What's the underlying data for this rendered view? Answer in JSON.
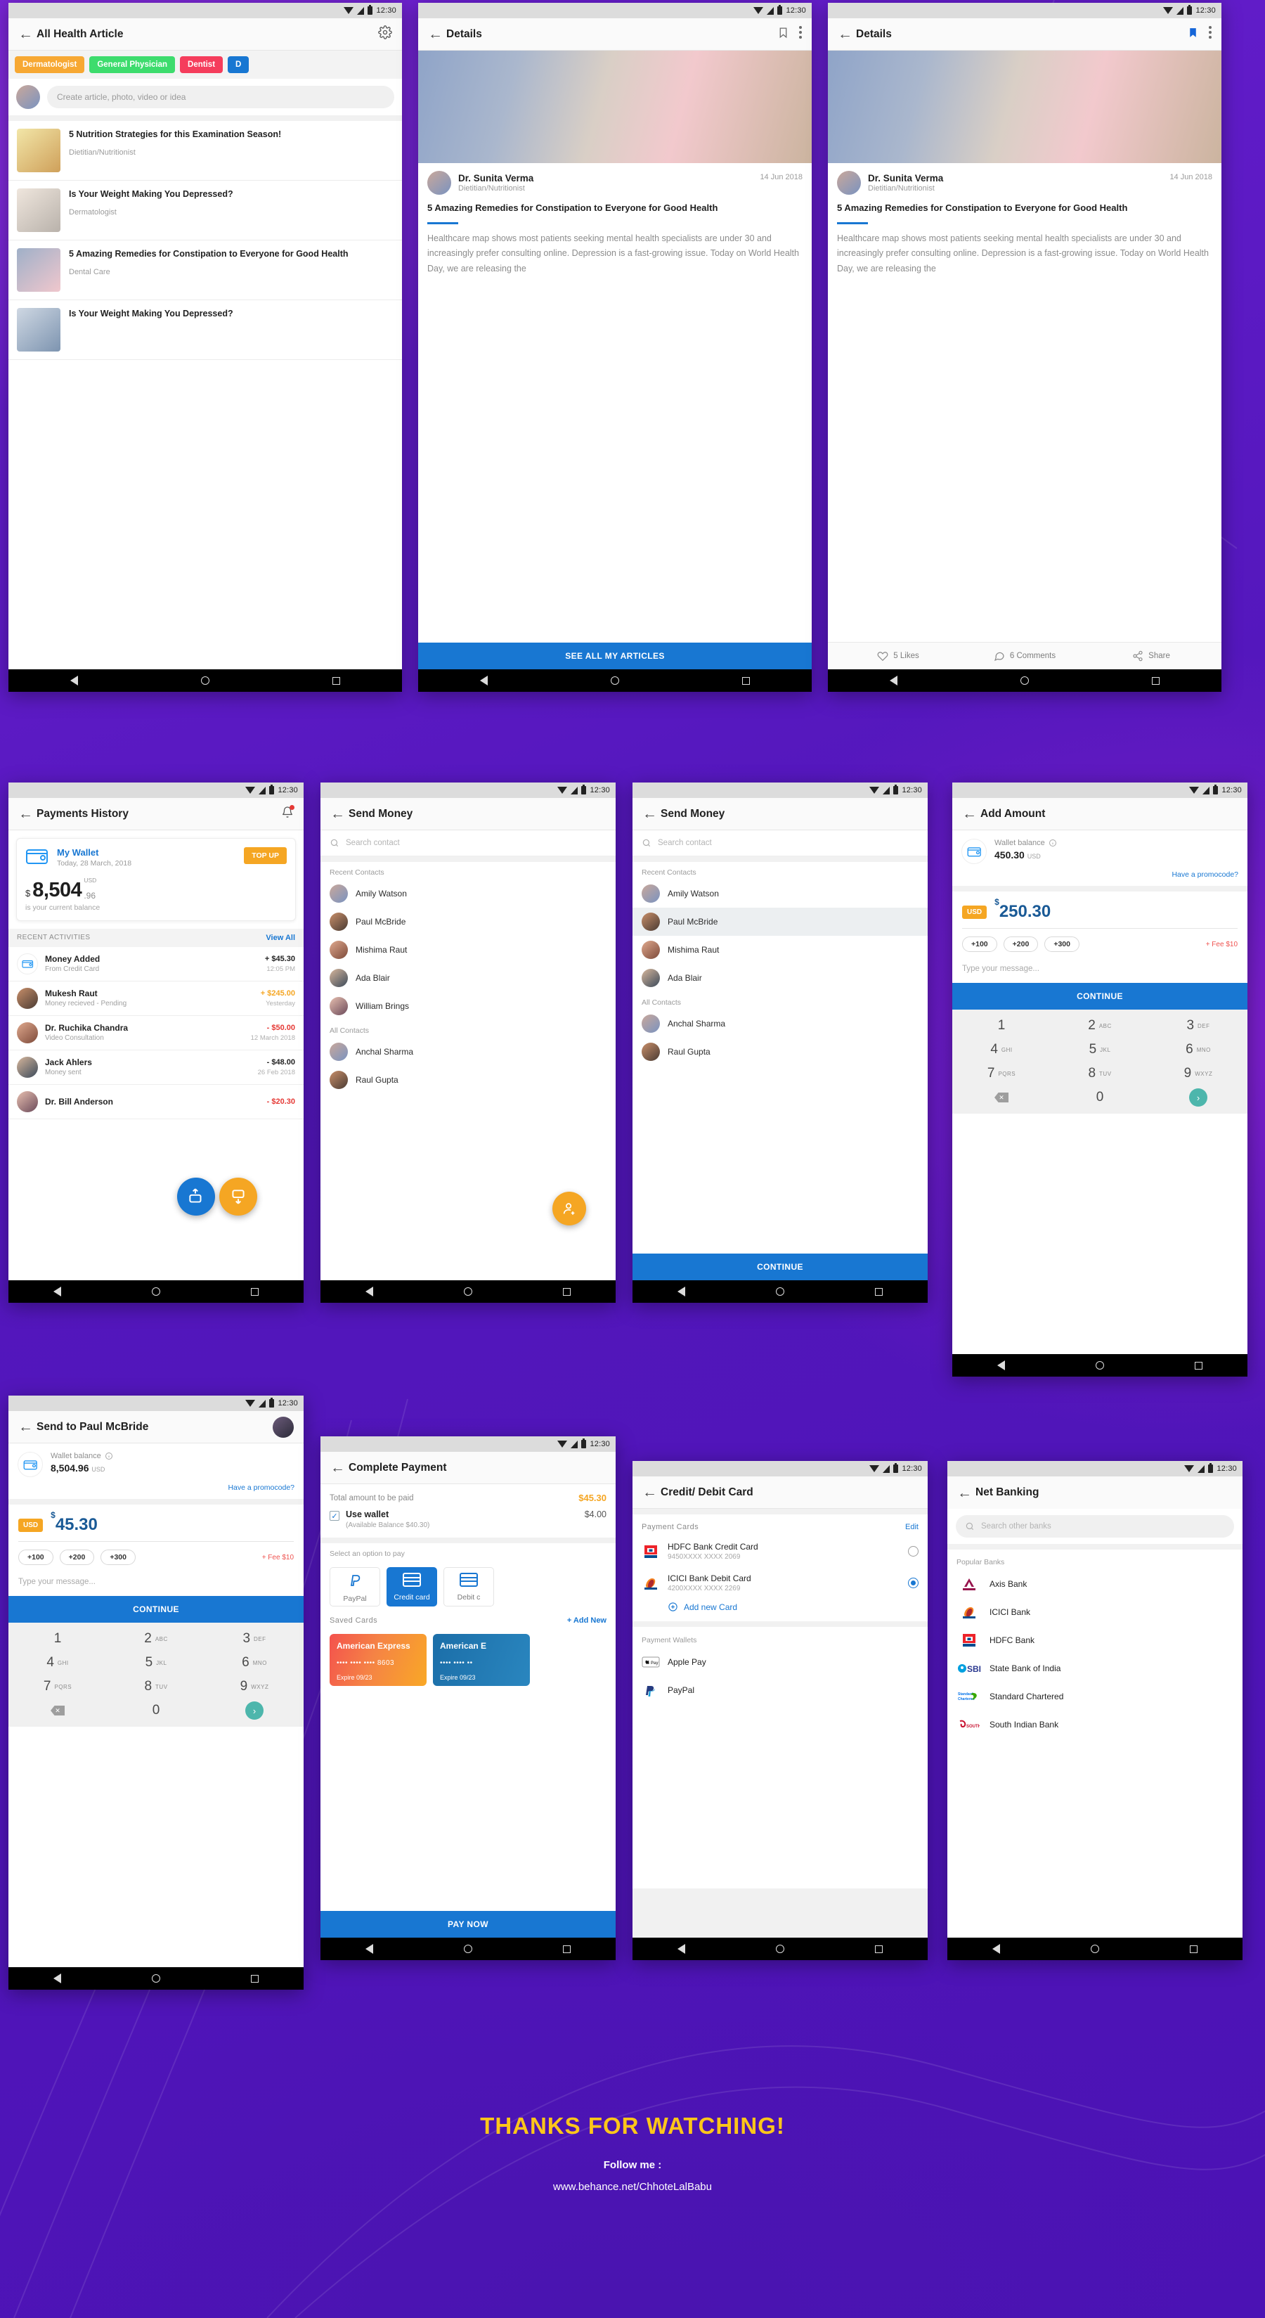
{
  "statusbar": {
    "time": "12:30"
  },
  "screens": {
    "article_list": {
      "title": "All Health Article",
      "gear_icon": "gear-icon",
      "chips": [
        {
          "label": "Dermatologist",
          "color": "#f7a833"
        },
        {
          "label": "General Physician",
          "color": "#3ddc6d"
        },
        {
          "label": "Dentist",
          "color": "#f53d5c"
        },
        {
          "label": "D",
          "color": "#1877d2"
        }
      ],
      "composer_placeholder": "Create article, photo, video or idea",
      "articles": [
        {
          "title": "5 Nutrition Strategies for this Examination Season!",
          "category": "Dietitian/Nutritionist"
        },
        {
          "title": "Is Your Weight Making You Depressed?",
          "category": "Dermatologist"
        },
        {
          "title": "5 Amazing Remedies for Constipation to Everyone for Good Health",
          "category": "Dental Care"
        },
        {
          "title": "Is Your Weight Making You Depressed?",
          "category": ""
        }
      ]
    },
    "details": {
      "title": "Details",
      "author": "Dr. Sunita Verma",
      "role": "Dietitian/Nutritionist",
      "date": "14 Jun 2018",
      "headline": "5 Amazing Remedies for Constipation to Everyone for Good Health",
      "body": "Healthcare map shows most patients seeking mental health specialists are under 30 and increasingly prefer consulting online. Depression is a fast-growing issue. Today on World Health Day, we are releasing the",
      "cta": "SEE ALL MY ARTICLES",
      "likes": "5 Likes",
      "comments": "6 Comments",
      "share": "Share"
    },
    "payments_history": {
      "title": "Payments History",
      "wallet_title": "My Wallet",
      "wallet_date": "Today, 28 March, 2018",
      "topup": "TOP UP",
      "currency_symbol": "$",
      "balance_whole": "8,504",
      "balance_cents": ".96",
      "balance_currency": "USD",
      "balance_caption": "is your current balance",
      "section_label": "RECENT ACTIVITIES",
      "view_all": "View All",
      "activities": [
        {
          "title": "Money Added",
          "sub": "From Credit Card",
          "amount": "+ $45.30",
          "color": "#222222",
          "time": "12:05 PM"
        },
        {
          "title": "Mukesh Raut",
          "sub": "Money recieved - Pending",
          "amount": "+ $245.00",
          "color": "#f5a623",
          "time": "Yesterday"
        },
        {
          "title": "Dr. Ruchika Chandra",
          "sub": "Video Consultation",
          "amount": "- $50.00",
          "color": "#e53935",
          "time": "12 March 2018"
        },
        {
          "title": "Jack Ahlers",
          "sub": "Money sent",
          "amount": "- $48.00",
          "color": "#222222",
          "time": "26 Feb 2018"
        },
        {
          "title": "Dr. Bill Anderson",
          "sub": "",
          "amount": "- $20.30",
          "color": "#e53935",
          "time": ""
        }
      ]
    },
    "send_money": {
      "title": "Send Money",
      "search_placeholder": "Search contact",
      "recent_label": "Recent Contacts",
      "all_label": "All Contacts",
      "recent_a": [
        "Amily Watson",
        "Paul McBride",
        "Mishima Raut",
        "Ada Blair",
        "William Brings"
      ],
      "all_a": [
        "Anchal Sharma",
        "Raul Gupta"
      ],
      "recent_b": [
        "Amily Watson",
        "Paul McBride",
        "Mishima Raut",
        "Ada Blair"
      ],
      "all_b": [
        "Anchal Sharma",
        "Raul Gupta"
      ],
      "selected": "Paul McBride",
      "continue": "CONTINUE"
    },
    "add_amount": {
      "title": "Add Amount",
      "wallet_label": "Wallet balance",
      "wallet_value": "450.30",
      "wallet_currency": "USD",
      "promocode": "Have a promocode?",
      "usd_tag": "USD",
      "amount": "250.30",
      "quick": [
        "+100",
        "+200",
        "+300"
      ],
      "fee": "+ Fee $10",
      "message_placeholder": "Type your message...",
      "continue": "CONTINUE"
    },
    "send_to": {
      "title": "Send to Paul McBride",
      "wallet_label": "Wallet balance",
      "wallet_value": "8,504.96",
      "wallet_currency": "USD",
      "promocode": "Have a promocode?",
      "usd_tag": "USD",
      "amount": "45.30",
      "quick": [
        "+100",
        "+200",
        "+300"
      ],
      "fee": "+ Fee $10",
      "message_placeholder": "Type your message...",
      "continue": "CONTINUE"
    },
    "keypad": {
      "keys": [
        {
          "n": "1",
          "l": ""
        },
        {
          "n": "2",
          "l": "ABC"
        },
        {
          "n": "3",
          "l": "DEF"
        },
        {
          "n": "4",
          "l": "GHI"
        },
        {
          "n": "5",
          "l": "JKL"
        },
        {
          "n": "6",
          "l": "MNO"
        },
        {
          "n": "7",
          "l": "PQRS"
        },
        {
          "n": "8",
          "l": "TUV"
        },
        {
          "n": "9",
          "l": "WXYZ"
        }
      ],
      "zero": "0",
      "delete_icon": "backspace-icon",
      "go_icon": "chevron-right-icon"
    },
    "complete_payment": {
      "title": "Complete Payment",
      "total_label": "Total amount to be paid",
      "total_value": "$45.30",
      "use_wallet": "Use wallet",
      "available_balance": "(Available Balance $40.30)",
      "wallet_value": "$4.00",
      "select_label": "Select an option to pay",
      "options": [
        {
          "label": "PayPal",
          "icon": "paypal-icon",
          "active": false
        },
        {
          "label": "Credit card",
          "icon": "credit-card-icon",
          "active": true
        },
        {
          "label": "Debit c",
          "icon": "debit-card-icon",
          "active": false
        }
      ],
      "saved_cards_label": "Saved Cards",
      "add_new": "+ Add New",
      "cards": [
        {
          "brand": "American Express",
          "number": "•••• •••• •••• 8603",
          "expire": "Expire 09/23",
          "theme": "orange"
        },
        {
          "brand": "American E",
          "number": "•••• •••• ••",
          "expire": "Expire 09/23",
          "theme": "blue"
        }
      ],
      "pay_now": "PAY NOW"
    },
    "credit_debit": {
      "title": "Credit/ Debit Card",
      "cards_label": "Payment Cards",
      "edit": "Edit",
      "cards": [
        {
          "name": "HDFC Bank Credit Card",
          "number": "9450XXXX XXXX 2069",
          "selected": false,
          "logo": "hdfc-logo"
        },
        {
          "name": "ICICI Bank Debit Card",
          "number": "4200XXXX XXXX 2269",
          "selected": true,
          "logo": "icici-logo"
        }
      ],
      "add_new_card": "Add new Card",
      "wallets_label": "Payment Wallets",
      "wallets": [
        {
          "name": "Apple Pay",
          "logo": "apple-pay-logo"
        },
        {
          "name": "PayPal",
          "logo": "paypal-logo"
        }
      ]
    },
    "net_banking": {
      "title": "Net Banking",
      "search_placeholder": "Search other banks",
      "popular_label": "Popular Banks",
      "banks": [
        {
          "name": "Axis Bank",
          "logo": "axis-bank-logo"
        },
        {
          "name": "ICICI Bank",
          "logo": "icici-bank-logo"
        },
        {
          "name": "HDFC Bank",
          "logo": "hdfc-bank-logo"
        },
        {
          "name": "State Bank of India",
          "logo": "sbi-logo"
        },
        {
          "name": "Standard Chartered",
          "logo": "standard-chartered-logo"
        },
        {
          "name": "South Indian Bank",
          "logo": "south-indian-bank-logo"
        }
      ]
    }
  },
  "footer": {
    "thanks": "THANKS FOR WATCHING!",
    "follow": "Follow me :",
    "link": "www.behance.net/ChhoteLalBabu"
  }
}
